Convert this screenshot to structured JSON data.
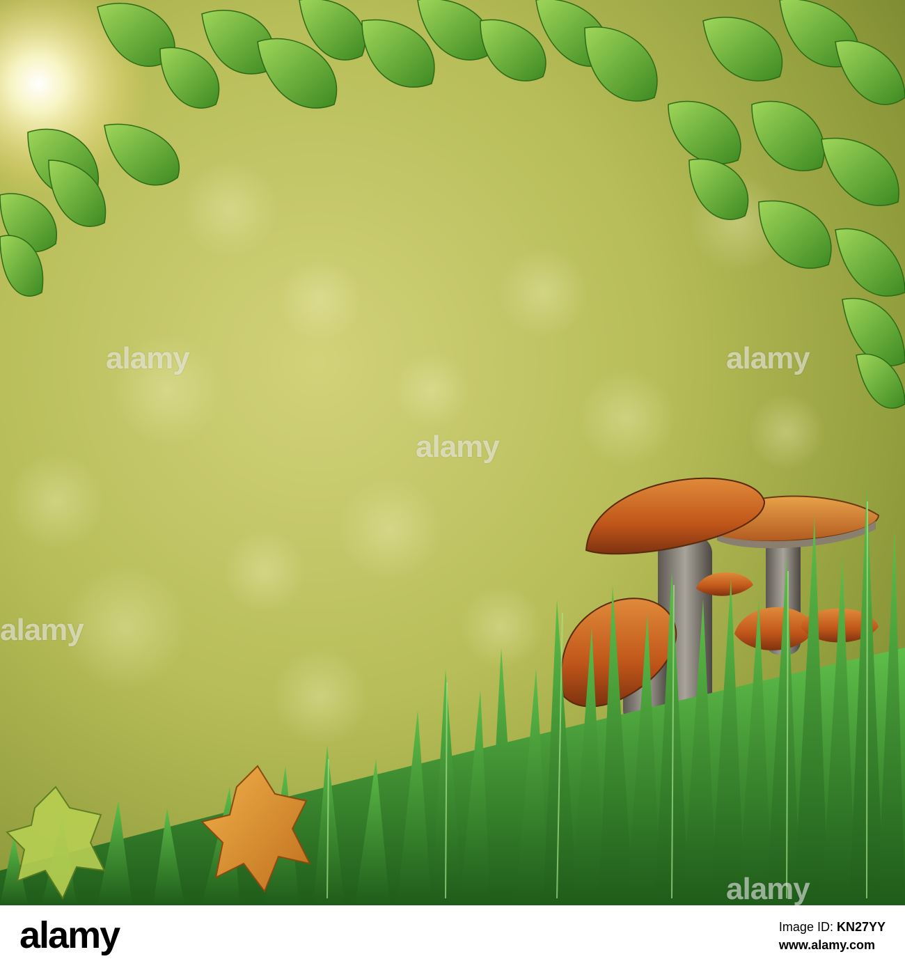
{
  "watermark": {
    "text": "alamy"
  },
  "footer": {
    "logo_text": "alamy",
    "image_id_label": "Image ID:",
    "image_id": "KN27YY",
    "url": "www.alamy.com"
  },
  "colors": {
    "background_green": "#b8c24a",
    "cap_orange": "#c5601c",
    "grass_green": "#2f8a2a",
    "leaf_green": "#6fb23a"
  },
  "scene": {
    "icons": [
      "sun-flare",
      "birch-leaves",
      "mushroom",
      "grass",
      "maple-leaf"
    ]
  }
}
